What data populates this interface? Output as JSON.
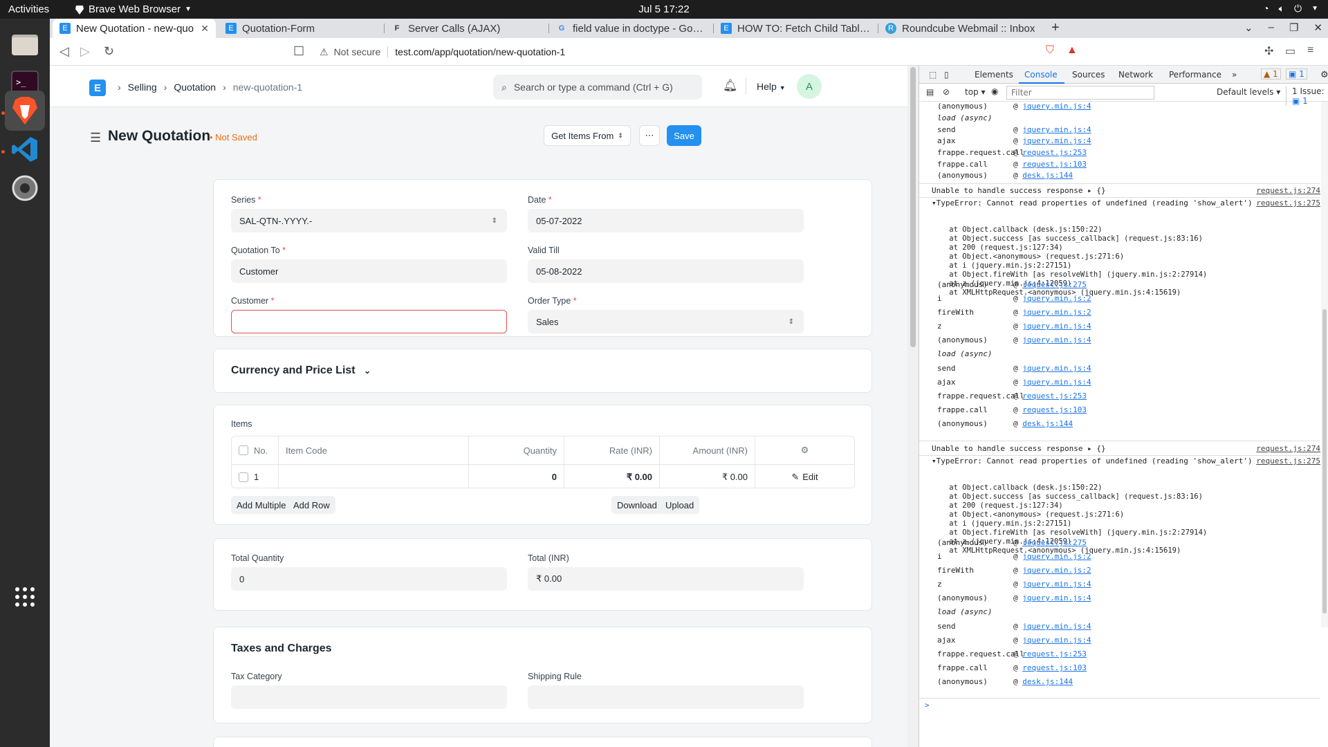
{
  "os": {
    "activities": "Activities",
    "app_name": "Brave Web Browser",
    "clock": "Jul 5  17:22"
  },
  "browser": {
    "tabs": [
      {
        "label": "New Quotation - new-quo",
        "icon": "E",
        "color": "#2490ef"
      },
      {
        "label": "Quotation-Form",
        "icon": "E",
        "color": "#2490ef"
      },
      {
        "label": "Server Calls (AJAX)",
        "icon": "F",
        "color": "#333333"
      },
      {
        "label": "field value in doctype - Google",
        "icon": "G",
        "color": "#4285f4"
      },
      {
        "label": "HOW TO: Fetch Child Tables -",
        "icon": "E",
        "color": "#2490ef"
      },
      {
        "label": "Roundcube Webmail :: Inbox",
        "icon": "R",
        "color": "#37a0d8"
      }
    ],
    "not_secure": "Not secure",
    "url": "test.com/app/quotation/new-quotation-1"
  },
  "app": {
    "breadcrumbs": [
      "Selling",
      "Quotation",
      "new-quotation-1"
    ],
    "search_placeholder": "Search or type a command (Ctrl + G)",
    "help": "Help",
    "avatar": "A",
    "title": "New Quotation",
    "indicator": "Not Saved",
    "get_items": "Get Items From",
    "save": "Save",
    "fields": {
      "series_label": "Series",
      "series_value": "SAL-QTN-.YYYY.-",
      "date_label": "Date",
      "date_value": "05-07-2022",
      "quotation_to_label": "Quotation To",
      "quotation_to_value": "Customer",
      "valid_till_label": "Valid Till",
      "valid_till_value": "05-08-2022",
      "customer_label": "Customer",
      "customer_value": "",
      "order_type_label": "Order Type",
      "order_type_value": "Sales"
    },
    "currency_section": "Currency and Price List",
    "items": {
      "label": "Items",
      "columns": [
        "No.",
        "Item Code",
        "Quantity",
        "Rate (INR)",
        "Amount (INR)"
      ],
      "row": {
        "no": "1",
        "item_code": "",
        "quantity": "0",
        "rate": "₹ 0.00",
        "amount": "₹ 0.00",
        "edit": "Edit"
      },
      "add_multiple": "Add Multiple",
      "add_row": "Add Row",
      "download": "Download",
      "upload": "Upload"
    },
    "totals": {
      "qty_label": "Total Quantity",
      "qty_value": "0",
      "total_label": "Total (INR)",
      "total_value": "₹ 0.00"
    },
    "taxes": {
      "title": "Taxes and Charges",
      "tax_category": "Tax Category",
      "shipping_rule": "Shipping Rule"
    }
  },
  "devtools": {
    "tabs": [
      "Elements",
      "Console",
      "Sources",
      "Network",
      "Performance"
    ],
    "warn_count": "1",
    "info_count": "1",
    "context": "top",
    "filter_placeholder": "Filter",
    "levels": "Default levels",
    "issues": "1 Issue:",
    "issue_count": "1",
    "top_stack": [
      {
        "fn": "(anonymous)",
        "src": "jquery.min.js:4"
      },
      {
        "fn": "load (async)",
        "src": ""
      },
      {
        "fn": "send",
        "src": "jquery.min.js:4"
      },
      {
        "fn": "ajax",
        "src": "jquery.min.js:4"
      },
      {
        "fn": "frappe.request.call",
        "src": "request.js:253"
      },
      {
        "fn": "frappe.call",
        "src": "request.js:103"
      },
      {
        "fn": "(anonymous)",
        "src": "desk.js:144"
      }
    ],
    "unable": "Unable to handle success response ▸ {}",
    "unable_src": "request.js:274",
    "error_head": "▾TypeError: Cannot read properties of undefined (reading 'show_alert')",
    "error_src": "request.js:275",
    "error_lines": [
      "    at Object.callback (desk.js:150:22)",
      "    at Object.success [as success_callback] (request.js:83:16)",
      "    at 200 (request.js:127:34)",
      "    at Object.<anonymous> (request.js:271:6)",
      "    at i (jquery.min.js:2:27151)",
      "    at Object.fireWith [as resolveWith] (jquery.min.js:2:27914)",
      "    at z (jquery.min.js:4:12059)",
      "    at XMLHttpRequest.<anonymous> (jquery.min.js:4:15619)"
    ],
    "stack": [
      {
        "fn": "(anonymous)",
        "src": "request.js:275"
      },
      {
        "fn": "i",
        "src": "jquery.min.js:2"
      },
      {
        "fn": "fireWith",
        "src": "jquery.min.js:2"
      },
      {
        "fn": "z",
        "src": "jquery.min.js:4"
      },
      {
        "fn": "(anonymous)",
        "src": "jquery.min.js:4"
      },
      {
        "fn": "load (async)",
        "src": ""
      },
      {
        "fn": "send",
        "src": "jquery.min.js:4"
      },
      {
        "fn": "ajax",
        "src": "jquery.min.js:4"
      },
      {
        "fn": "frappe.request.call",
        "src": "request.js:253"
      },
      {
        "fn": "frappe.call",
        "src": "request.js:103"
      },
      {
        "fn": "(anonymous)",
        "src": "desk.js:144"
      }
    ],
    "prompt": ">"
  }
}
